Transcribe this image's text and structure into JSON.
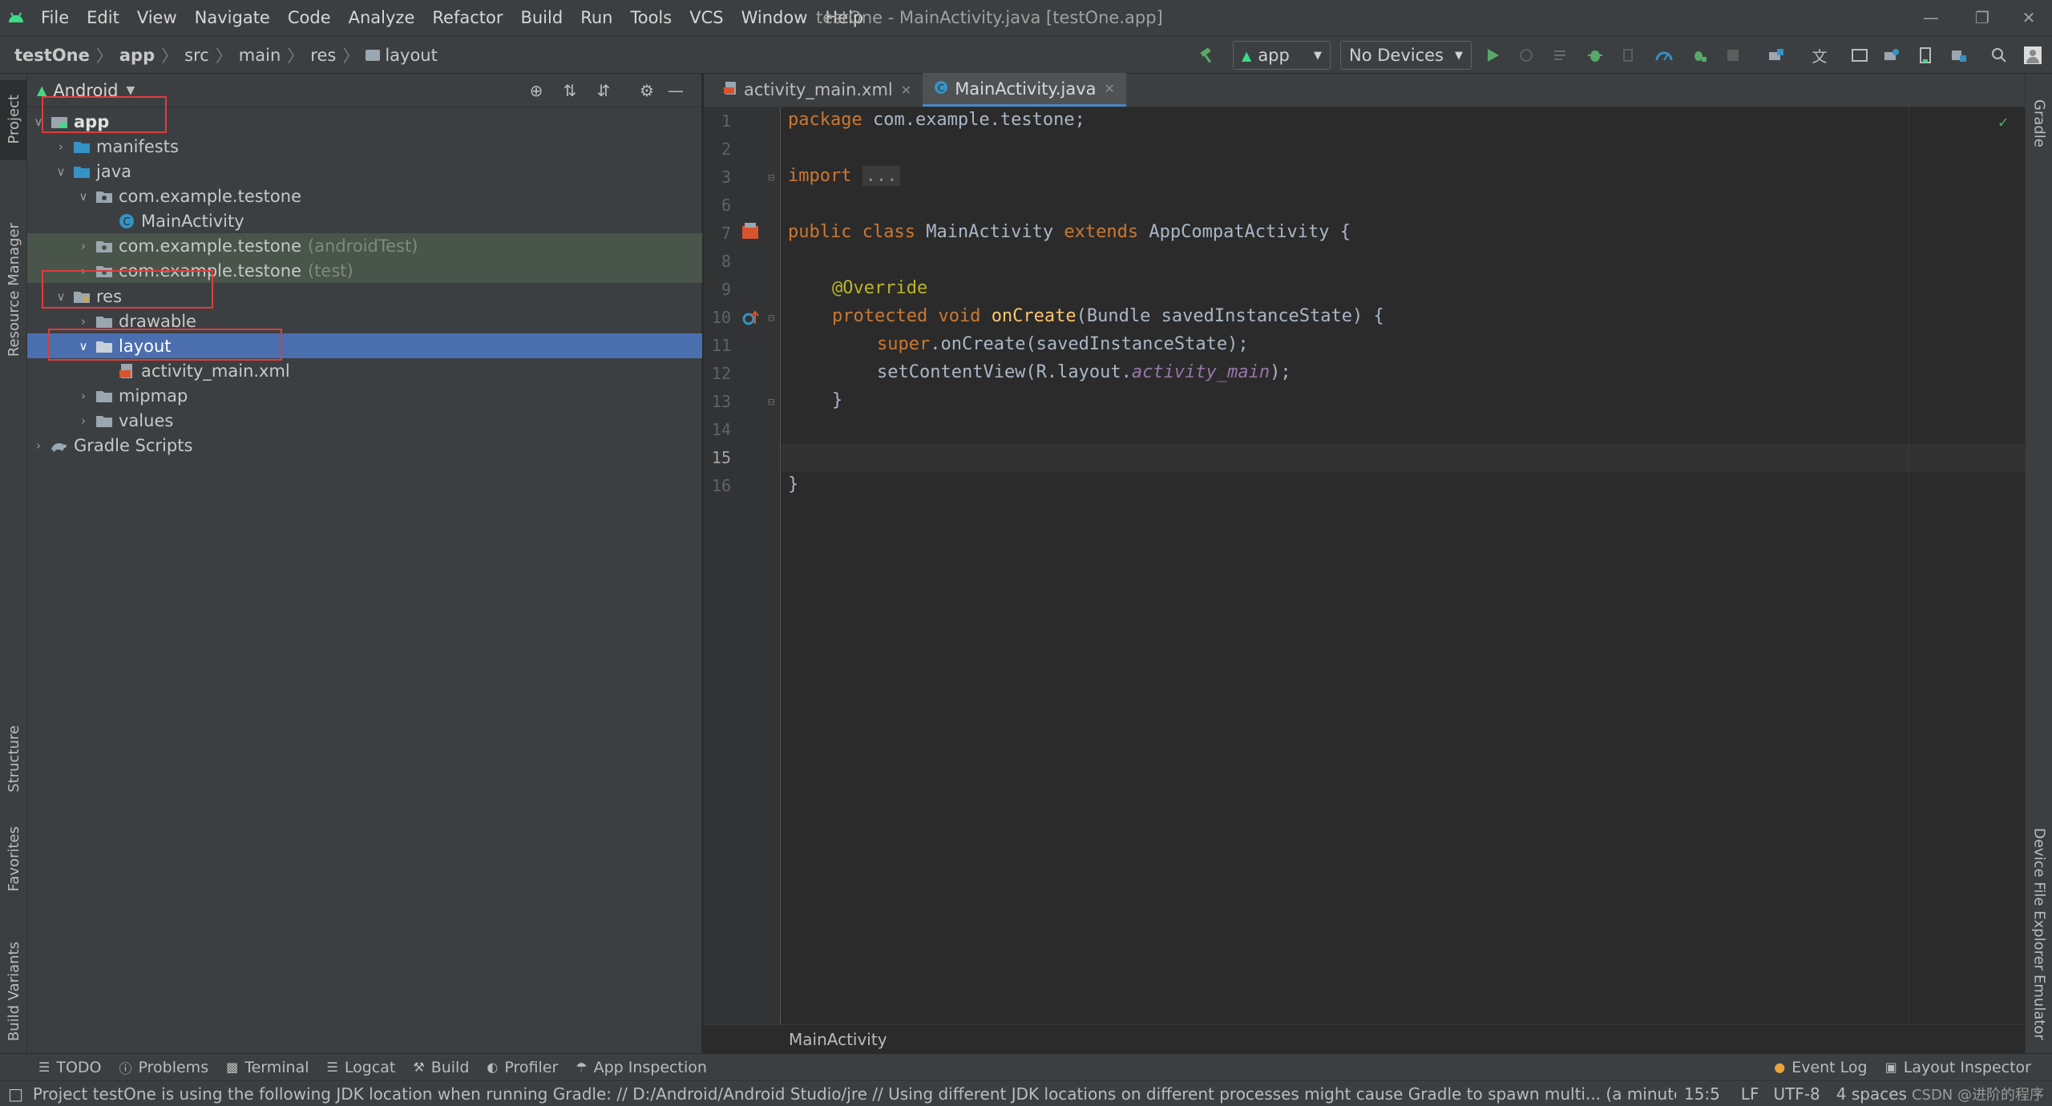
{
  "menubar": {
    "items": [
      "File",
      "Edit",
      "View",
      "Navigate",
      "Code",
      "Analyze",
      "Refactor",
      "Build",
      "Run",
      "Tools",
      "VCS",
      "Window",
      "Help"
    ],
    "window_title": "testOne - MainActivity.java [testOne.app]"
  },
  "navbar": {
    "breadcrumbs": [
      "testOne",
      "app",
      "src",
      "main",
      "res",
      "layout"
    ],
    "run_config": "app",
    "device": "No Devices"
  },
  "project_panel": {
    "view": "Android",
    "tree": [
      {
        "label": "app",
        "level": 0,
        "expanded": true,
        "icon": "module-icon"
      },
      {
        "label": "manifests",
        "level": 1,
        "expanded": false,
        "icon": "folder-icon"
      },
      {
        "label": "java",
        "level": 1,
        "expanded": true,
        "icon": "folder-icon"
      },
      {
        "label": "com.example.testone",
        "level": 2,
        "expanded": true,
        "icon": "package-icon"
      },
      {
        "label": "MainActivity",
        "level": 3,
        "icon": "class-icon"
      },
      {
        "label": "com.example.testone",
        "suffix": "(androidTest)",
        "level": 2,
        "expanded": false,
        "icon": "package-icon"
      },
      {
        "label": "com.example.testone",
        "suffix": "(test)",
        "level": 2,
        "expanded": false,
        "icon": "package-icon"
      },
      {
        "label": "res",
        "level": 1,
        "expanded": true,
        "icon": "res-folder-icon"
      },
      {
        "label": "drawable",
        "level": 2,
        "expanded": false,
        "icon": "folder-icon"
      },
      {
        "label": "layout",
        "level": 2,
        "expanded": true,
        "icon": "folder-icon",
        "selected": true
      },
      {
        "label": "activity_main.xml",
        "level": 3,
        "icon": "xml-file-icon"
      },
      {
        "label": "mipmap",
        "level": 2,
        "expanded": false,
        "icon": "folder-icon"
      },
      {
        "label": "values",
        "level": 2,
        "expanded": false,
        "icon": "folder-icon"
      },
      {
        "label": "Gradle Scripts",
        "level": 0,
        "expanded": false,
        "icon": "gradle-icon"
      }
    ]
  },
  "editor": {
    "tabs": [
      {
        "label": "activity_main.xml",
        "active": false
      },
      {
        "label": "MainActivity.java",
        "active": true
      }
    ],
    "line_numbers": [
      "1",
      "2",
      "3",
      "6",
      "7",
      "8",
      "9",
      "10",
      "11",
      "12",
      "13",
      "14",
      "15",
      "16"
    ],
    "current_line": "15",
    "code": {
      "l1_kw": "package",
      "l1_rest": " com.example.testone;",
      "l3_kw": "import",
      "l3_fold": "...",
      "l7_kw1": "public class",
      "l7_name": " MainActivity ",
      "l7_kw2": "extends",
      "l7_rest": " AppCompatActivity {",
      "l9_ann": "@Override",
      "l10_kw": "protected void",
      "l10_fn": "onCreate",
      "l10_rest": "(Bundle savedInstanceState) {",
      "l11_kw": "super",
      "l11_rest": ".onCreate(savedInstanceState);",
      "l12_pre": "setContentView(R.layout.",
      "l12_it": "activity_main",
      "l12_post": ");",
      "l13": "}",
      "l16": "}"
    },
    "bottom_breadcrumb": "MainActivity"
  },
  "left_strip": [
    "Project",
    "Resource Manager",
    "Structure",
    "Favorites",
    "Build Variants"
  ],
  "right_strip": [
    "Gradle",
    "Device File Explorer",
    "Emulator"
  ],
  "tool_windows": [
    "TODO",
    "Problems",
    "Terminal",
    "Logcat",
    "Build",
    "Profiler",
    "App Inspection"
  ],
  "tool_windows_right": [
    "Event Log",
    "Layout Inspector"
  ],
  "status": {
    "message": "Project testOne is using the following JDK location when running Gradle: // D:/Android/Android Studio/jre // Using different JDK locations on different processes might cause Gradle to spawn multi... (a minute ago)",
    "position": "15:5",
    "line_sep": "LF",
    "encoding": "UTF-8",
    "indent": "4 spaces",
    "watermark": "CSDN @进阶的程序"
  },
  "colors": {
    "selection": "#4b6eaf",
    "annotation_box": "#e03c3c",
    "keyword": "#cc7832",
    "function": "#ffc66d"
  }
}
